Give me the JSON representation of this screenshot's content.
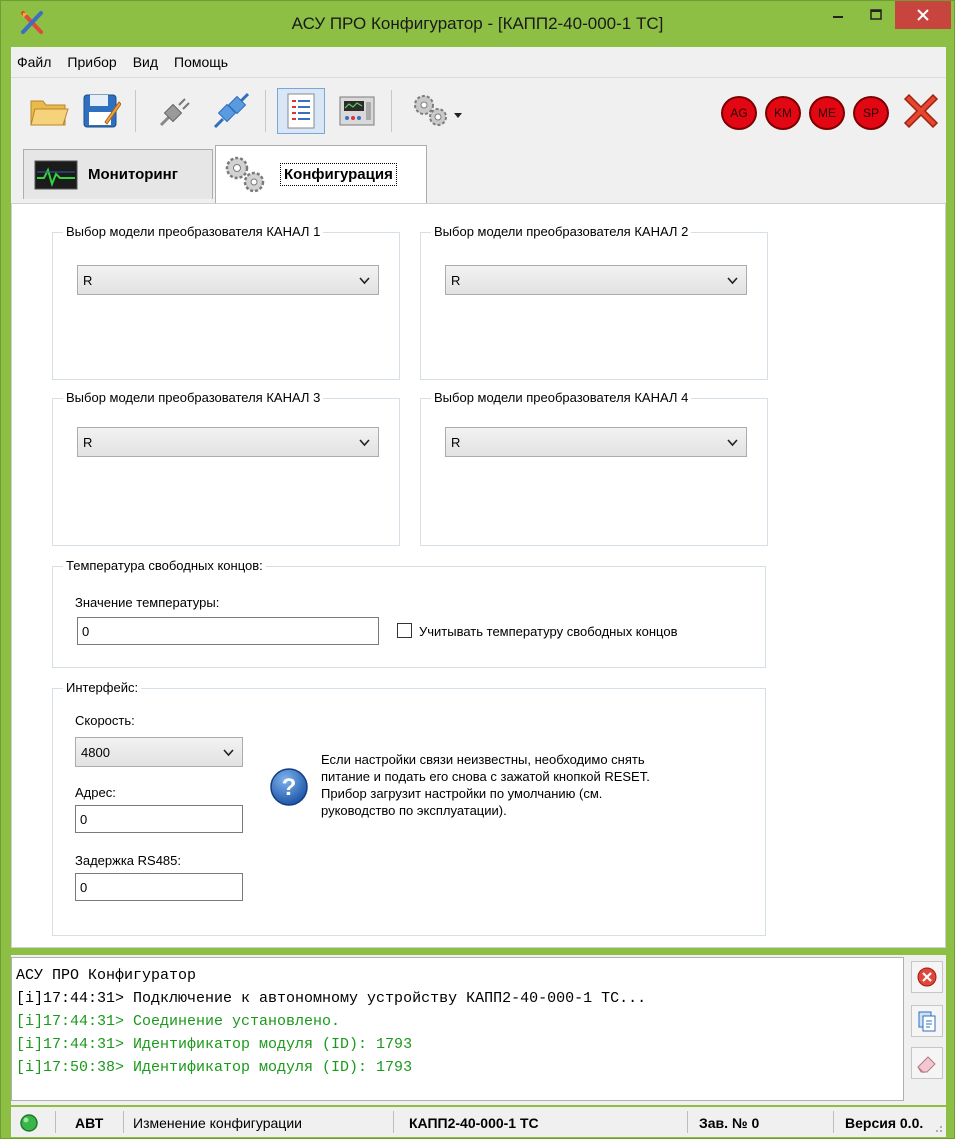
{
  "window": {
    "title": "АСУ ПРО Конфигуратор - [КАПП2-40-000-1 ТС]",
    "accent_color": "#8dbf45",
    "close_color": "#c7443f"
  },
  "menu": [
    "Файл",
    "Прибор",
    "Вид",
    "Помощь"
  ],
  "toolbar": {
    "buttons": [
      "open-folder-icon",
      "save-icon",
      "disconnect-plug-icon",
      "connect-plug-icon",
      "config-view-icon",
      "monitor-view-icon",
      "settings-gears-icon"
    ],
    "indicators": [
      "AG",
      "KM",
      "ME",
      "SP"
    ],
    "indicator_color": "#e30613"
  },
  "tabs": [
    {
      "label": "Мониторинг",
      "icon": "monitor-chart-icon",
      "active": false
    },
    {
      "label": "Конфигурация",
      "icon": "gears-icon",
      "active": true
    }
  ],
  "config": {
    "channels": [
      {
        "title": "Выбор модели преобразователя  КАНАЛ 1",
        "value": "R"
      },
      {
        "title": "Выбор модели преобразователя  КАНАЛ 2",
        "value": "R"
      },
      {
        "title": "Выбор модели преобразователя  КАНАЛ 3",
        "value": "R"
      },
      {
        "title": "Выбор модели преобразователя  КАНАЛ 4",
        "value": "R"
      }
    ],
    "cold_junction": {
      "title": "Температура свободных концов:",
      "value_label": "Значение температуры:",
      "value": "0",
      "checkbox_label": "Учитывать температуру свободных концов",
      "checked": false
    },
    "interface": {
      "title": "Интерфейс:",
      "speed_label": "Скорость:",
      "speed_value": "4800",
      "address_label": "Адрес:",
      "address_value": "0",
      "delay_label": "Задержка RS485:",
      "delay_value": "0",
      "info_lines": [
        "Если настройки связи неизвестны, необходимо снять",
        "питание и подать его снова с зажатой кнопкой RESET.",
        "Прибор загрузит настройки по умолчанию (см.",
        "руководство по эксплуатации)."
      ]
    }
  },
  "log": {
    "lines": [
      {
        "text": "АСУ ПРО Конфигуратор",
        "color": "#000000"
      },
      {
        "text": "[i]17:44:31> Подключение к автономному устройству КАПП2-40-000-1 ТС...",
        "color": "#000000"
      },
      {
        "text": "[i]17:44:31> Соединение установлено.",
        "color": "#1a9a1a"
      },
      {
        "text": "[i]17:44:31> Идентификатор модуля (ID): 1793",
        "color": "#1a9a1a"
      },
      {
        "text": "[i]17:50:38> Идентификатор модуля (ID): 1793",
        "color": "#1a9a1a"
      }
    ]
  },
  "statusbar": {
    "mode": "АВТ",
    "state": "Изменение конфигурации",
    "device": "КАПП2-40-000-1 ТС",
    "serial": "Зав. № 0",
    "version": "Версия 0.0.",
    "led_color": "#39b54a"
  }
}
